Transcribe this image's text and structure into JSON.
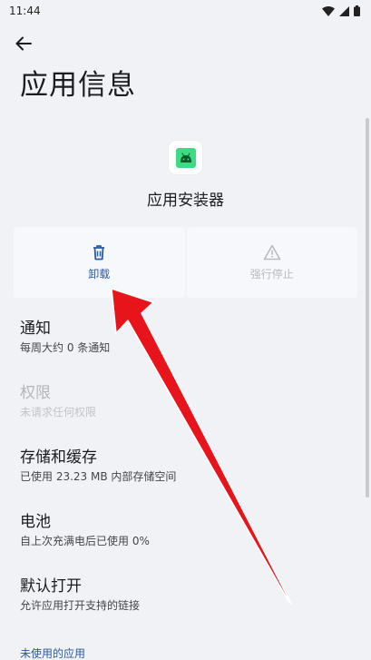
{
  "status_bar": {
    "time": "11:44",
    "icons": [
      "wifi-icon",
      "signal-icon",
      "battery-icon"
    ]
  },
  "header": {
    "back_icon": "arrow-left-icon",
    "title": "应用信息"
  },
  "app": {
    "name": "应用安装器",
    "icon": "android-icon",
    "icon_color": "#3ddc84"
  },
  "actions": {
    "uninstall": {
      "label": "卸载",
      "icon": "trash-icon",
      "enabled": true
    },
    "force_stop": {
      "label": "强行停止",
      "icon": "warning-icon",
      "enabled": false
    }
  },
  "settings": [
    {
      "title": "通知",
      "subtitle": "每周大约 0 条通知",
      "enabled": true
    },
    {
      "title": "权限",
      "subtitle": "未请求任何权限",
      "enabled": false
    },
    {
      "title": "存储和缓存",
      "subtitle": "已使用 23.23 MB 内部存储空间",
      "enabled": true
    },
    {
      "title": "电池",
      "subtitle": "自上次充满电后已使用 0%",
      "enabled": true
    },
    {
      "title": "默认打开",
      "subtitle": "允许应用打开支持的链接",
      "enabled": true
    }
  ],
  "section_header": "未使用的应用",
  "colors": {
    "background": "#f1f2f6",
    "accent": "#2b5aa0",
    "annotation_arrow": "#e8141c"
  }
}
